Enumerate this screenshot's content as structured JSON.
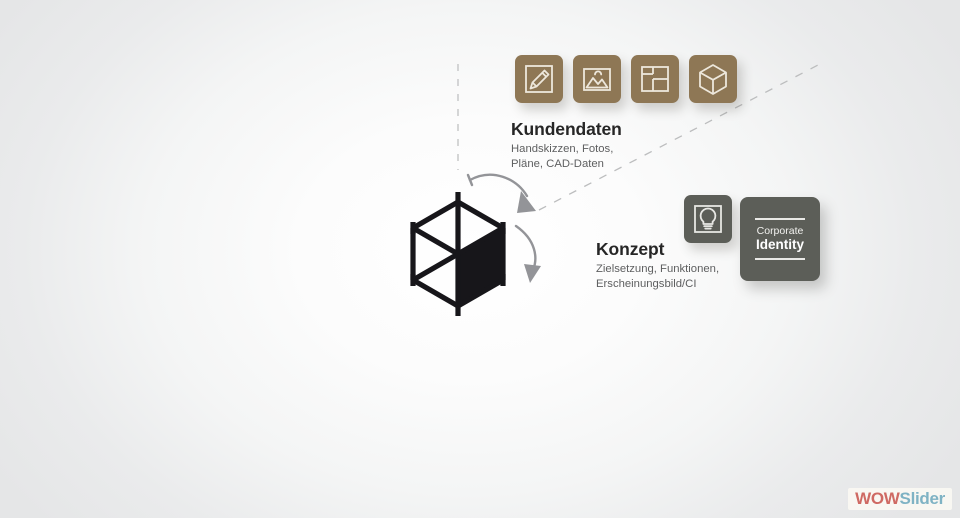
{
  "watermark": {
    "part1": "WOW",
    "part2": "Slider"
  },
  "colors": {
    "brown_tile": "#8e7755",
    "gray_tile": "#5c5e58",
    "heading_text": "#262626",
    "subtitle_text": "#5e5f60",
    "cube_fill": "#17161a",
    "arrow": "#8f9094",
    "dashed_line": "#b9babb",
    "watermark_wow": "#cf6a63",
    "watermark_slider": "#7fb3c4",
    "background": "#e8e9ea"
  },
  "groups": [
    {
      "id": "kundendaten",
      "heading": "Kundendaten",
      "subtitle_lines": [
        "Handskizzen, Fotos,",
        "Pläne, CAD-Daten"
      ],
      "icons": [
        {
          "name": "pencil-sketch-icon",
          "label": "Handskizze"
        },
        {
          "name": "photo-image-icon",
          "label": "Foto"
        },
        {
          "name": "floor-plan-icon",
          "label": "Pläne"
        },
        {
          "name": "3d-cube-icon",
          "label": "CAD-Daten"
        }
      ]
    },
    {
      "id": "konzept",
      "heading": "Konzept",
      "subtitle_lines": [
        "Zielsetzung, Funktionen,",
        "Erscheinungsbild/CI"
      ],
      "icons": [
        {
          "name": "lightbulb-idea-icon",
          "label": "Konzept"
        }
      ],
      "card": {
        "name": "corporate-identity-card",
        "line1": "Corporate",
        "line2": "Identity"
      }
    }
  ],
  "diagram": {
    "center_object": "isometric-wireframe-cube",
    "arrows": [
      {
        "name": "arrow-from-cube-to-kundendaten",
        "direction": "clockwise-upper"
      },
      {
        "name": "arrow-from-cube-to-konzept",
        "direction": "clockwise-lower"
      }
    ],
    "guide_lines": [
      {
        "name": "vertical-dashed-guide"
      },
      {
        "name": "diagonal-dashed-guide"
      }
    ]
  }
}
